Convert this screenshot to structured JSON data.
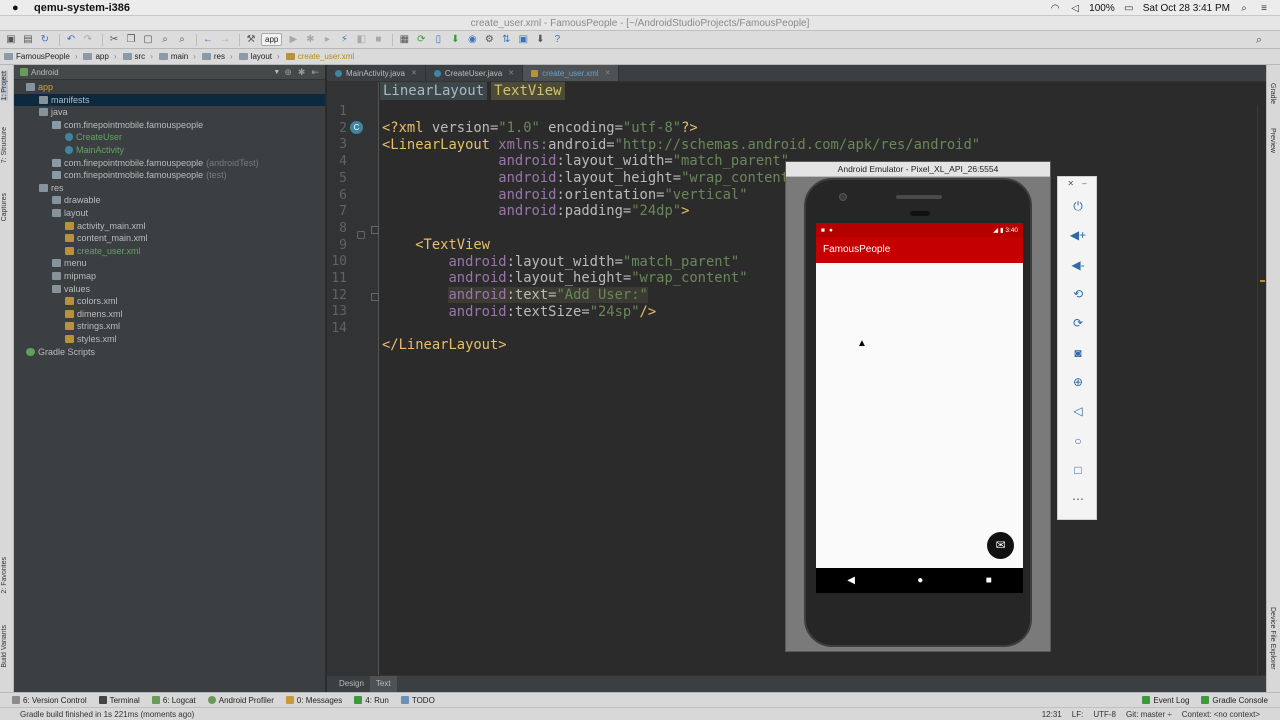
{
  "menubar": {
    "app": "qemu-system-i386",
    "battery": "100%",
    "datetime": "Sat Oct 28  3:41 PM"
  },
  "window": {
    "title": "create_user.xml - FamousPeople - [~/AndroidStudioProjects/FamousPeople]"
  },
  "toolbar": {
    "run_config": "app"
  },
  "breadcrumb": [
    "FamousPeople",
    "app",
    "src",
    "main",
    "res",
    "layout",
    "create_user.xml"
  ],
  "left_tabs": [
    "1: Project",
    "7: Structure",
    "Captures",
    "2: Favorites",
    "Build Variants"
  ],
  "right_tabs": [
    "Gradle",
    "Preview",
    "Device File Explorer"
  ],
  "project": {
    "view": "Android",
    "tree": [
      {
        "label": "app",
        "depth": 0,
        "arrow": "▼",
        "icon": "folder",
        "color": "yellow"
      },
      {
        "label": "manifests",
        "depth": 1,
        "arrow": "▶",
        "icon": "folder",
        "color": "",
        "selected": true
      },
      {
        "label": "java",
        "depth": 1,
        "arrow": "▼",
        "icon": "folder",
        "color": ""
      },
      {
        "label": "com.finepointmobile.famouspeople",
        "depth": 2,
        "arrow": "▼",
        "icon": "pkg",
        "color": ""
      },
      {
        "label": "CreateUser",
        "depth": 3,
        "arrow": "",
        "icon": "java",
        "color": "green"
      },
      {
        "label": "MainActivity",
        "depth": 3,
        "arrow": "",
        "icon": "java",
        "color": "green"
      },
      {
        "label": "com.finepointmobile.famouspeople",
        "suffix": "(androidTest)",
        "depth": 2,
        "arrow": "▶",
        "icon": "pkg",
        "color": ""
      },
      {
        "label": "com.finepointmobile.famouspeople",
        "suffix": "(test)",
        "depth": 2,
        "arrow": "▶",
        "icon": "pkg",
        "color": ""
      },
      {
        "label": "res",
        "depth": 1,
        "arrow": "▼",
        "icon": "folder",
        "color": ""
      },
      {
        "label": "drawable",
        "depth": 2,
        "arrow": "▶",
        "icon": "folder",
        "color": ""
      },
      {
        "label": "layout",
        "depth": 2,
        "arrow": "▼",
        "icon": "folder",
        "color": ""
      },
      {
        "label": "activity_main.xml",
        "depth": 3,
        "arrow": "",
        "icon": "xml",
        "color": ""
      },
      {
        "label": "content_main.xml",
        "depth": 3,
        "arrow": "",
        "icon": "xml",
        "color": ""
      },
      {
        "label": "create_user.xml",
        "depth": 3,
        "arrow": "",
        "icon": "xml",
        "color": "green"
      },
      {
        "label": "menu",
        "depth": 2,
        "arrow": "▶",
        "icon": "folder",
        "color": ""
      },
      {
        "label": "mipmap",
        "depth": 2,
        "arrow": "▶",
        "icon": "folder",
        "color": ""
      },
      {
        "label": "values",
        "depth": 2,
        "arrow": "▼",
        "icon": "folder",
        "color": ""
      },
      {
        "label": "colors.xml",
        "depth": 3,
        "arrow": "",
        "icon": "xml",
        "color": ""
      },
      {
        "label": "dimens.xml",
        "depth": 3,
        "arrow": "",
        "icon": "xml",
        "color": ""
      },
      {
        "label": "strings.xml",
        "depth": 3,
        "arrow": "",
        "icon": "xml",
        "color": ""
      },
      {
        "label": "styles.xml",
        "depth": 3,
        "arrow": "",
        "icon": "xml",
        "color": ""
      },
      {
        "label": "Gradle Scripts",
        "depth": 0,
        "arrow": "▶",
        "icon": "gradle",
        "color": ""
      }
    ]
  },
  "tabs": [
    {
      "label": "MainActivity.java",
      "active": false
    },
    {
      "label": "CreateUser.java",
      "active": false
    },
    {
      "label": "create_user.xml",
      "active": true
    }
  ],
  "editor": {
    "crumbs": [
      "LinearLayout",
      "TextView"
    ],
    "line_numbers": [
      "1",
      "2",
      "3",
      "4",
      "5",
      "6",
      "7",
      "8",
      "9",
      "10",
      "11",
      "12",
      "13",
      "14"
    ]
  },
  "design_tabs": [
    "Design",
    "Text"
  ],
  "tool_windows": {
    "left": [
      "6: Version Control",
      "Terminal",
      "6: Logcat",
      "Android Profiler",
      "0: Messages",
      "4: Run",
      "TODO"
    ],
    "right": [
      "Event Log",
      "Gradle Console"
    ]
  },
  "status": {
    "message": "Gradle build finished in 1s 221ms (moments ago)",
    "position": "12:31",
    "lf": "LF:",
    "encoding": "UTF-8",
    "git": "Git: master ÷",
    "context": "Context: <no context>"
  },
  "emulator": {
    "title": "Android Emulator - Pixel_XL_API_26:5554",
    "clock": "3:40",
    "app_title": "FamousPeople"
  }
}
